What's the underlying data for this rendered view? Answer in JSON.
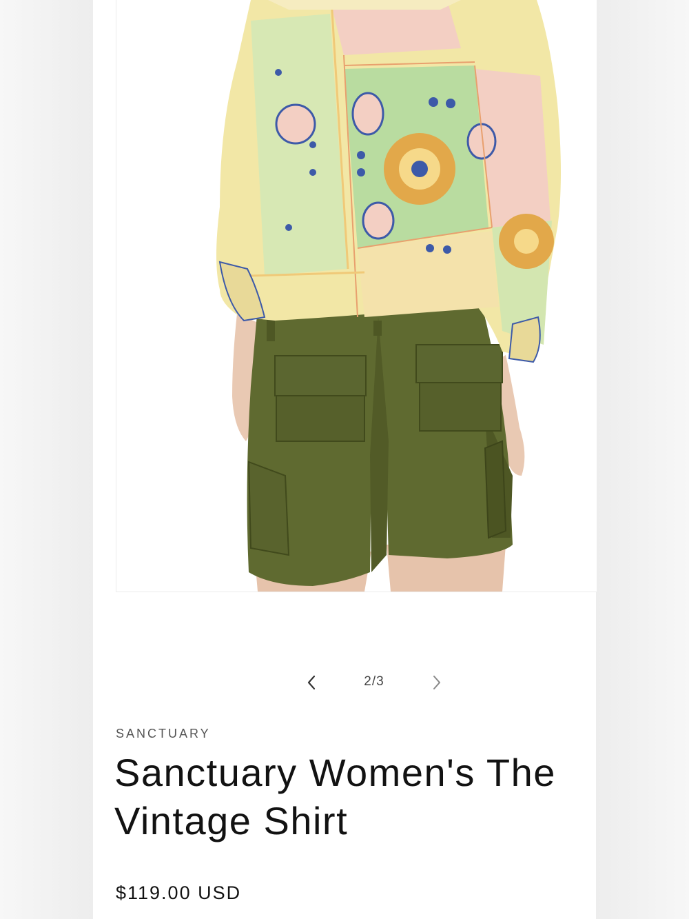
{
  "product": {
    "vendor": "SANCTUARY",
    "title": "Sanctuary Women's The Vintage Shirt",
    "price": "$119.00 USD"
  },
  "gallery": {
    "counter": "2/3",
    "image_alt": "Back view of model wearing paisley print shirt and olive cargo shorts",
    "prev_icon": "chevron-left-icon",
    "next_icon": "chevron-right-icon"
  },
  "colors": {
    "shirt_green": "#b9dca0",
    "shirt_yellow": "#f2e7a6",
    "shirt_pink": "#f3cfc3",
    "shirt_orange": "#e2a84a",
    "shirt_blue": "#3d5aa8",
    "shorts_olive": "#5f6a30",
    "skin": "#e9c9b3"
  }
}
